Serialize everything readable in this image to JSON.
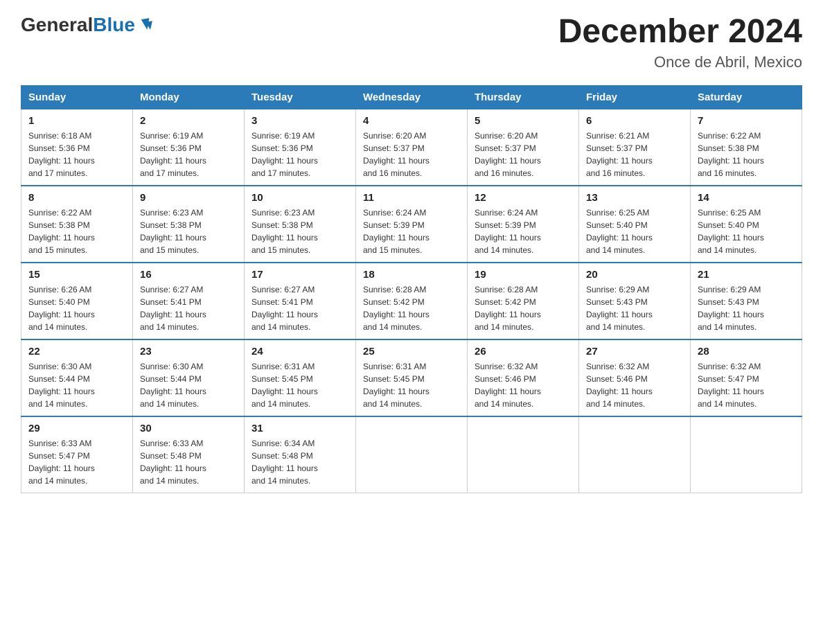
{
  "header": {
    "logo": {
      "general_text": "General",
      "blue_text": "Blue"
    },
    "title": "December 2024",
    "location": "Once de Abril, Mexico"
  },
  "calendar": {
    "days_of_week": [
      "Sunday",
      "Monday",
      "Tuesday",
      "Wednesday",
      "Thursday",
      "Friday",
      "Saturday"
    ],
    "weeks": [
      [
        {
          "day": "1",
          "sunrise": "6:18 AM",
          "sunset": "5:36 PM",
          "daylight": "11 hours and 17 minutes."
        },
        {
          "day": "2",
          "sunrise": "6:19 AM",
          "sunset": "5:36 PM",
          "daylight": "11 hours and 17 minutes."
        },
        {
          "day": "3",
          "sunrise": "6:19 AM",
          "sunset": "5:36 PM",
          "daylight": "11 hours and 17 minutes."
        },
        {
          "day": "4",
          "sunrise": "6:20 AM",
          "sunset": "5:37 PM",
          "daylight": "11 hours and 16 minutes."
        },
        {
          "day": "5",
          "sunrise": "6:20 AM",
          "sunset": "5:37 PM",
          "daylight": "11 hours and 16 minutes."
        },
        {
          "day": "6",
          "sunrise": "6:21 AM",
          "sunset": "5:37 PM",
          "daylight": "11 hours and 16 minutes."
        },
        {
          "day": "7",
          "sunrise": "6:22 AM",
          "sunset": "5:38 PM",
          "daylight": "11 hours and 16 minutes."
        }
      ],
      [
        {
          "day": "8",
          "sunrise": "6:22 AM",
          "sunset": "5:38 PM",
          "daylight": "11 hours and 15 minutes."
        },
        {
          "day": "9",
          "sunrise": "6:23 AM",
          "sunset": "5:38 PM",
          "daylight": "11 hours and 15 minutes."
        },
        {
          "day": "10",
          "sunrise": "6:23 AM",
          "sunset": "5:38 PM",
          "daylight": "11 hours and 15 minutes."
        },
        {
          "day": "11",
          "sunrise": "6:24 AM",
          "sunset": "5:39 PM",
          "daylight": "11 hours and 15 minutes."
        },
        {
          "day": "12",
          "sunrise": "6:24 AM",
          "sunset": "5:39 PM",
          "daylight": "11 hours and 14 minutes."
        },
        {
          "day": "13",
          "sunrise": "6:25 AM",
          "sunset": "5:40 PM",
          "daylight": "11 hours and 14 minutes."
        },
        {
          "day": "14",
          "sunrise": "6:25 AM",
          "sunset": "5:40 PM",
          "daylight": "11 hours and 14 minutes."
        }
      ],
      [
        {
          "day": "15",
          "sunrise": "6:26 AM",
          "sunset": "5:40 PM",
          "daylight": "11 hours and 14 minutes."
        },
        {
          "day": "16",
          "sunrise": "6:27 AM",
          "sunset": "5:41 PM",
          "daylight": "11 hours and 14 minutes."
        },
        {
          "day": "17",
          "sunrise": "6:27 AM",
          "sunset": "5:41 PM",
          "daylight": "11 hours and 14 minutes."
        },
        {
          "day": "18",
          "sunrise": "6:28 AM",
          "sunset": "5:42 PM",
          "daylight": "11 hours and 14 minutes."
        },
        {
          "day": "19",
          "sunrise": "6:28 AM",
          "sunset": "5:42 PM",
          "daylight": "11 hours and 14 minutes."
        },
        {
          "day": "20",
          "sunrise": "6:29 AM",
          "sunset": "5:43 PM",
          "daylight": "11 hours and 14 minutes."
        },
        {
          "day": "21",
          "sunrise": "6:29 AM",
          "sunset": "5:43 PM",
          "daylight": "11 hours and 14 minutes."
        }
      ],
      [
        {
          "day": "22",
          "sunrise": "6:30 AM",
          "sunset": "5:44 PM",
          "daylight": "11 hours and 14 minutes."
        },
        {
          "day": "23",
          "sunrise": "6:30 AM",
          "sunset": "5:44 PM",
          "daylight": "11 hours and 14 minutes."
        },
        {
          "day": "24",
          "sunrise": "6:31 AM",
          "sunset": "5:45 PM",
          "daylight": "11 hours and 14 minutes."
        },
        {
          "day": "25",
          "sunrise": "6:31 AM",
          "sunset": "5:45 PM",
          "daylight": "11 hours and 14 minutes."
        },
        {
          "day": "26",
          "sunrise": "6:32 AM",
          "sunset": "5:46 PM",
          "daylight": "11 hours and 14 minutes."
        },
        {
          "day": "27",
          "sunrise": "6:32 AM",
          "sunset": "5:46 PM",
          "daylight": "11 hours and 14 minutes."
        },
        {
          "day": "28",
          "sunrise": "6:32 AM",
          "sunset": "5:47 PM",
          "daylight": "11 hours and 14 minutes."
        }
      ],
      [
        {
          "day": "29",
          "sunrise": "6:33 AM",
          "sunset": "5:47 PM",
          "daylight": "11 hours and 14 minutes."
        },
        {
          "day": "30",
          "sunrise": "6:33 AM",
          "sunset": "5:48 PM",
          "daylight": "11 hours and 14 minutes."
        },
        {
          "day": "31",
          "sunrise": "6:34 AM",
          "sunset": "5:48 PM",
          "daylight": "11 hours and 14 minutes."
        },
        null,
        null,
        null,
        null
      ]
    ],
    "sunrise_label": "Sunrise:",
    "sunset_label": "Sunset:",
    "daylight_label": "Daylight:"
  }
}
